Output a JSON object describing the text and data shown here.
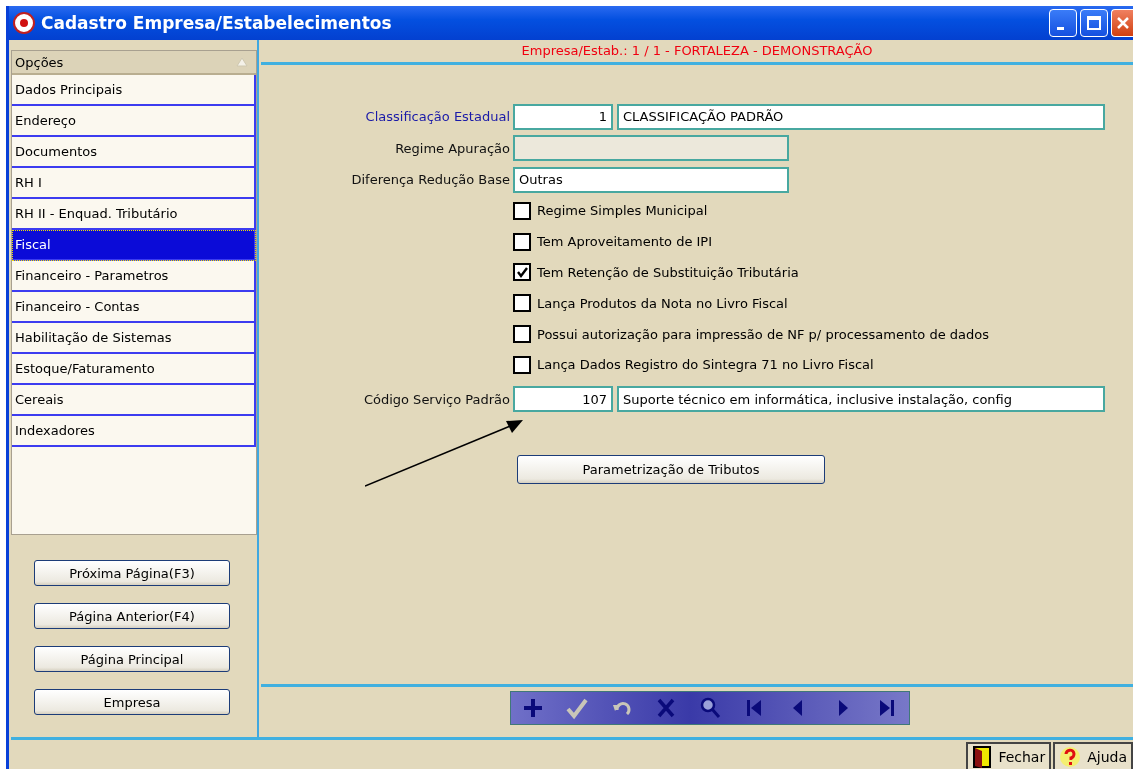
{
  "window": {
    "title": "Cadastro Empresa/Estabelecimentos"
  },
  "sidebar": {
    "header": "Opções",
    "items": [
      {
        "label": "Dados Principais",
        "selected": false
      },
      {
        "label": "Endereço",
        "selected": false
      },
      {
        "label": "Documentos",
        "selected": false
      },
      {
        "label": "RH I",
        "selected": false
      },
      {
        "label": "RH II - Enquad. Tributário",
        "selected": false
      },
      {
        "label": "Fiscal",
        "selected": true
      },
      {
        "label": "Financeiro - Parametros",
        "selected": false
      },
      {
        "label": "Financeiro - Contas",
        "selected": false
      },
      {
        "label": "Habilitação de Sistemas",
        "selected": false
      },
      {
        "label": "Estoque/Faturamento",
        "selected": false
      },
      {
        "label": "Cereais",
        "selected": false
      },
      {
        "label": "Indexadores",
        "selected": false
      }
    ],
    "buttons": [
      "Próxima Página(F3)",
      "Página Anterior(F4)",
      "Página Principal",
      "Empresa"
    ]
  },
  "header": "Empresa/Estab.: 1 / 1 - FORTALEZA -  DEMONSTRAÇÃO",
  "form": {
    "classificacao": {
      "label": "Classificação Estadual",
      "code": "1",
      "description": "CLASSIFICAÇÃO PADRÃO"
    },
    "regime": {
      "label": "Regime Apuração",
      "disabled": true
    },
    "diferenca": {
      "label": "Diferença Redução Base",
      "value": "Outras"
    },
    "checkboxes": [
      {
        "label": "Regime Simples Municipal",
        "checked": false
      },
      {
        "label": "Tem Aproveitamento de IPI",
        "checked": false
      },
      {
        "label": "Tem Retenção de Substituição Tributária",
        "checked": true
      },
      {
        "label": "Lança Produtos da Nota no Livro Fiscal",
        "checked": false
      },
      {
        "label": "Possui autorização para impressão de NF p/ processamento de dados",
        "checked": false
      },
      {
        "label": "Lança Dados Registro do Sintegra 71 no Livro Fiscal",
        "checked": false
      }
    ],
    "servico": {
      "label": "Código Serviço Padrão",
      "code": "107",
      "description": "Suporte técnico em informática, inclusive instalação, config"
    },
    "button": "Parametrização de Tributos"
  },
  "toolbar": [
    {
      "kind": "add",
      "disabled": false
    },
    {
      "kind": "confirm",
      "disabled": true
    },
    {
      "kind": "undo",
      "disabled": true
    },
    {
      "kind": "delete",
      "disabled": false
    },
    {
      "kind": "search",
      "disabled": false
    },
    {
      "kind": "first",
      "disabled": false
    },
    {
      "kind": "prev",
      "disabled": false
    },
    {
      "kind": "next",
      "disabled": false
    },
    {
      "kind": "last",
      "disabled": false
    }
  ],
  "status_bar": {
    "close": "Fechar",
    "help": "Ajuda"
  }
}
